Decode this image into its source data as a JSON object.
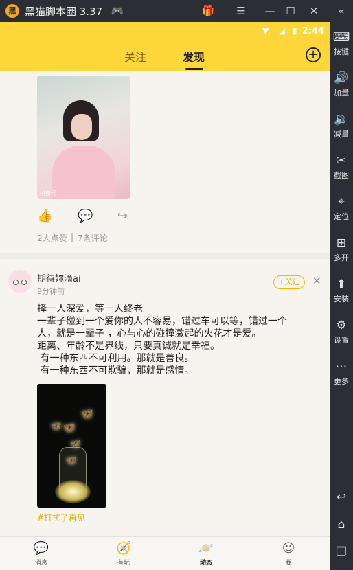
{
  "titlebar": {
    "app_title": "黑猫脚本圈 3.37",
    "logo": "黑"
  },
  "status_bar": {
    "time": "2:44"
  },
  "nav": {
    "tab_follow": "关注",
    "tab_discover": "发现"
  },
  "post1": {
    "likes": "2人点赞",
    "comments": "7条评论",
    "image_watermark": "抖音号"
  },
  "post2": {
    "username": "期待妳滴ai",
    "time": "9分钟前",
    "follow_label": "+关注",
    "lines": [
      "择一人深爱，等一人终老",
      "一辈子碰到一个爱你的人不容易，错过车可以等，错过一个",
      "人，就是一辈子 ，心与心的碰撞激起的火花才是爱。",
      "距离、年龄不是界线，只要真诚就是幸福。",
      " 有一种东西不可利用。那就是善良。",
      " 有一种东西不可欺骗，那就是感情。"
    ],
    "hashtag": "#打扰了再见"
  },
  "bottom_tabs": [
    {
      "label": "消息",
      "icon": "chat-icon"
    },
    {
      "label": "有玩",
      "icon": "compass-icon"
    },
    {
      "label": "动态",
      "icon": "planet-icon"
    },
    {
      "label": "我",
      "icon": "face-icon"
    }
  ],
  "sidebar": [
    {
      "label": "按键",
      "icon": "keyboard-icon"
    },
    {
      "label": "加量",
      "icon": "volume-up-icon"
    },
    {
      "label": "减量",
      "icon": "volume-down-icon"
    },
    {
      "label": "截图",
      "icon": "scissors-icon"
    },
    {
      "label": "定位",
      "icon": "location-icon"
    },
    {
      "label": "多开",
      "icon": "multi-open-icon"
    },
    {
      "label": "安装",
      "icon": "apk-install-icon"
    },
    {
      "label": "设置",
      "icon": "gear-icon"
    },
    {
      "label": "更多",
      "icon": "more-icon"
    }
  ],
  "colors": {
    "accent_yellow": "#fdd63a",
    "follow_orange": "#e0a800",
    "emulator_dark": "#2b2e35"
  }
}
